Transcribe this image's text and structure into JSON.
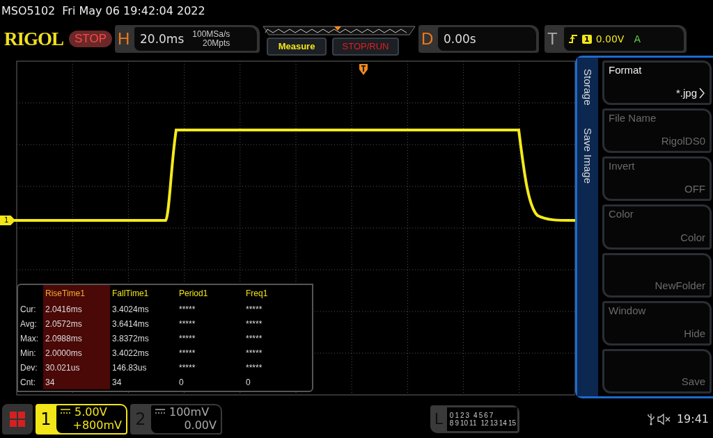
{
  "title_bar": {
    "model": "MSO5102",
    "datetime": "Fri May 06 19:42:04 2022"
  },
  "header": {
    "logo": "RIGOL",
    "run_state": "STOP",
    "horizontal": {
      "label": "H",
      "timebase": "20.0ms",
      "sample_rate": "100MSa/s",
      "memory_depth": "20Mpts"
    },
    "buttons": [
      {
        "label": "Measure",
        "kind": "measure"
      },
      {
        "label": "STOP/RUN",
        "kind": "run"
      }
    ],
    "delay": {
      "label": "D",
      "value": "0.00s"
    },
    "trigger": {
      "label": "T",
      "source": "1",
      "level": "0.00V",
      "mode": "A"
    }
  },
  "display": {
    "channel_marker": "1"
  },
  "measurements": {
    "columns": [
      {
        "label": "RiseTime1",
        "selected": true
      },
      {
        "label": "FallTime1",
        "selected": false
      },
      {
        "label": "Period1",
        "selected": false
      },
      {
        "label": "Freq1",
        "selected": false
      }
    ],
    "rows": [
      {
        "label": "Cur:",
        "values": [
          "2.0416ms",
          "3.4024ms",
          "*****",
          "*****"
        ]
      },
      {
        "label": "Avg:",
        "values": [
          "2.0572ms",
          "3.6414ms",
          "*****",
          "*****"
        ]
      },
      {
        "label": "Max:",
        "values": [
          "2.0988ms",
          "3.8372ms",
          "*****",
          "*****"
        ]
      },
      {
        "label": "Min:",
        "values": [
          "2.0000ms",
          "3.4022ms",
          "*****",
          "*****"
        ]
      },
      {
        "label": "Dev:",
        "values": [
          "30.021us",
          "146.83us",
          "*****",
          "*****"
        ]
      },
      {
        "label": "Cnt:",
        "values": [
          "34",
          "34",
          "0",
          "0"
        ]
      }
    ]
  },
  "menu": {
    "title": "Storage",
    "submenu": "Save Image",
    "softkeys": [
      {
        "label": "Format",
        "value": "*.jpg",
        "disabled": false,
        "arrow": true
      },
      {
        "label": "File Name",
        "value": "RigolDS0",
        "disabled": true,
        "arrow": false
      },
      {
        "label": "Invert",
        "value": "OFF",
        "disabled": true,
        "arrow": false
      },
      {
        "label": "Color",
        "value": "Color",
        "disabled": true,
        "arrow": false
      },
      {
        "value": "NewFolder",
        "disabled": true,
        "arrow": false
      },
      {
        "label": "Window",
        "value": "Hide",
        "disabled": true,
        "arrow": false
      },
      {
        "value": "Save",
        "disabled": true,
        "arrow": false
      }
    ]
  },
  "channels": [
    {
      "number": "1",
      "scale": "5.00V",
      "offset": "+800mV",
      "active": true
    },
    {
      "number": "2",
      "scale": "100mV",
      "offset": "0.00V",
      "active": false
    }
  ],
  "logic": {
    "label": "L",
    "row_1": [
      "0",
      "1",
      "2",
      "3",
      "4",
      "5",
      "6",
      "7"
    ],
    "row_2": [
      "8",
      "9",
      "10",
      "11",
      "12",
      "13",
      "14",
      "15"
    ]
  },
  "status": {
    "time": "19:41"
  }
}
